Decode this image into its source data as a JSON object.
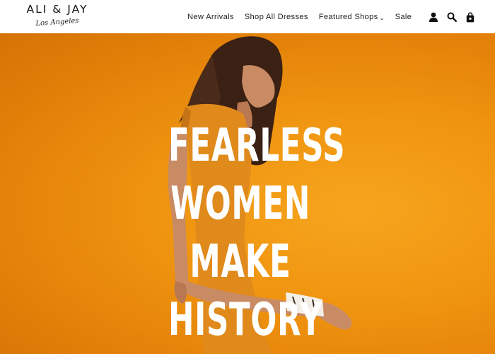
{
  "brand": {
    "name": "ALI & JAY",
    "tagline": "Los Angeles"
  },
  "nav": {
    "items": [
      {
        "label": "New Arrivals"
      },
      {
        "label": "Shop All Dresses"
      },
      {
        "label": "Featured Shops",
        "has_dropdown": true
      },
      {
        "label": "Sale"
      }
    ]
  },
  "header_icons": [
    "account-icon",
    "search-icon",
    "cart-icon"
  ],
  "hero": {
    "headline_lines": [
      "FEARLESS",
      "WOMEN",
      "MAKE",
      "HISTORY"
    ],
    "background_color": "#ef9410"
  },
  "colors": {
    "text": "#222222",
    "headline": "#ffffff"
  }
}
